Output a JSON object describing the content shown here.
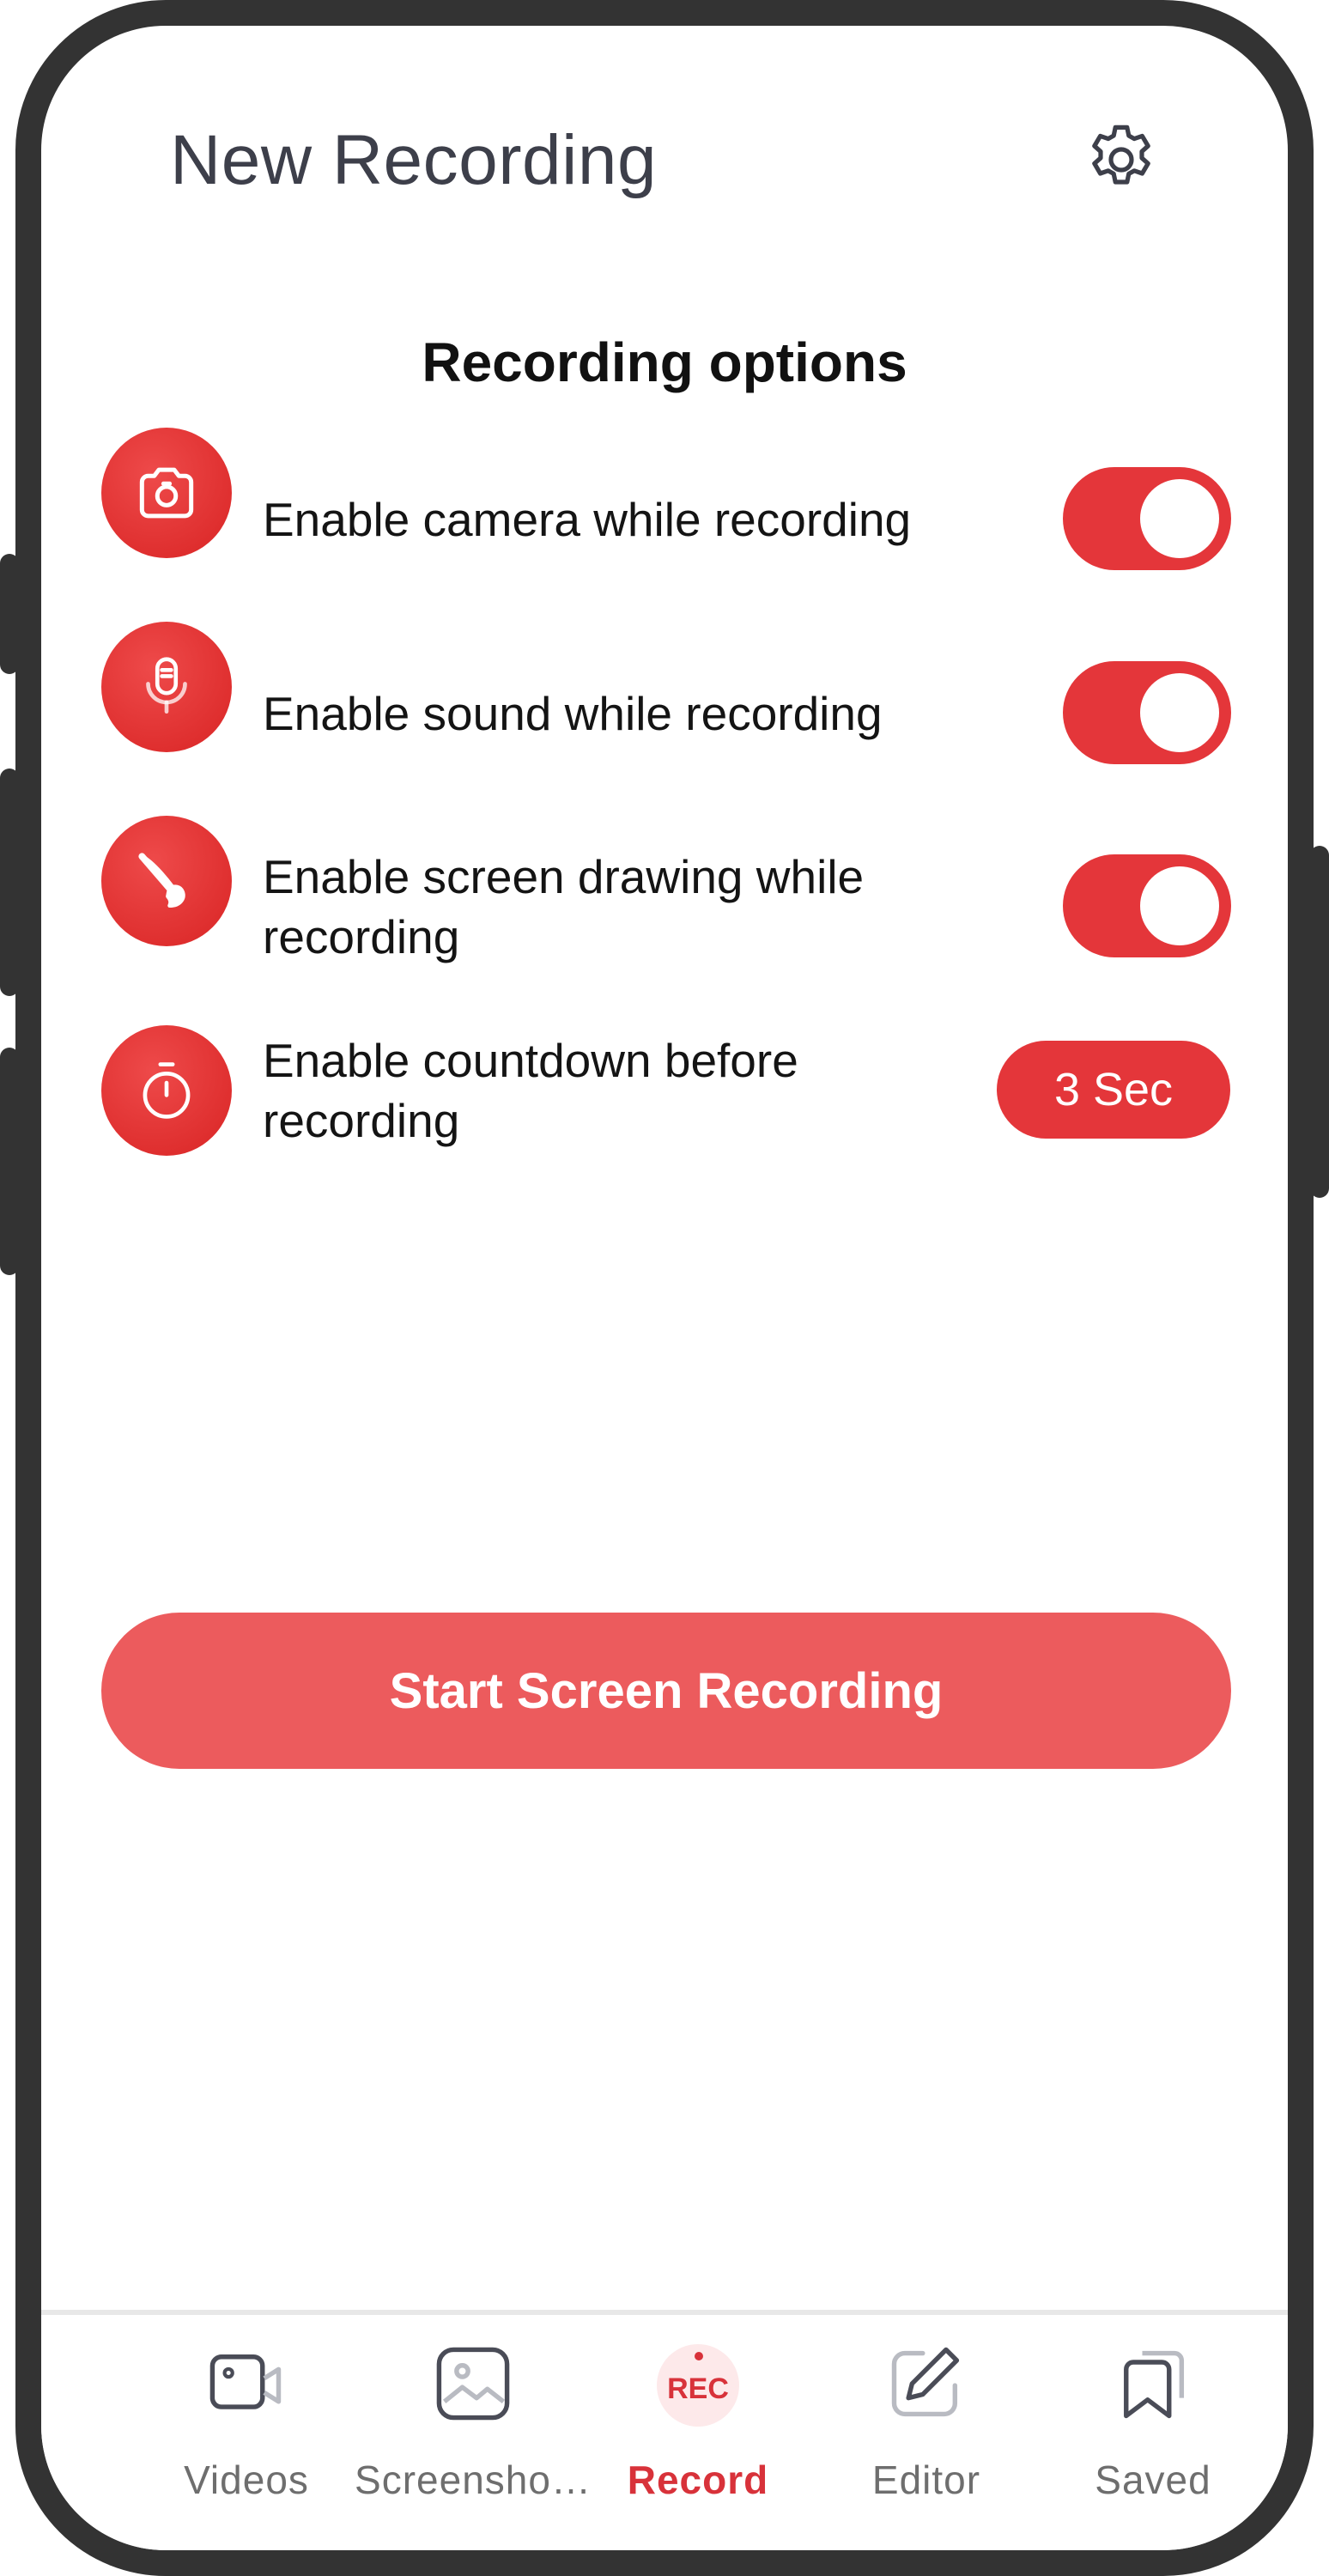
{
  "header": {
    "title": "New Recording"
  },
  "section": {
    "title": "Recording options"
  },
  "options": [
    {
      "label": "Enable camera while recording",
      "icon": "camera-icon",
      "enabled": true
    },
    {
      "label": "Enable sound while recording",
      "icon": "microphone-icon",
      "enabled": true
    },
    {
      "label": "Enable screen drawing while recording",
      "icon": "brush-icon",
      "enabled": true
    },
    {
      "label": "Enable countdown before recording",
      "icon": "stopwatch-icon",
      "value": "3 Sec"
    }
  ],
  "start_button": {
    "label": "Start Screen Recording"
  },
  "nav": {
    "items": [
      {
        "label": "Videos",
        "icon": "video-camera-icon",
        "active": false
      },
      {
        "label": "Screensho…",
        "icon": "image-icon",
        "active": false
      },
      {
        "label": "Record",
        "icon": "record-icon",
        "badge": "REC",
        "active": true
      },
      {
        "label": "Editor",
        "icon": "pencil-square-icon",
        "active": false
      },
      {
        "label": "Saved",
        "icon": "bookmark-icon",
        "active": false
      }
    ]
  },
  "colors": {
    "accent": "#e4363a",
    "start_button": "#ec5b5d",
    "frame": "#333333",
    "active_nav": "#d8323a"
  }
}
